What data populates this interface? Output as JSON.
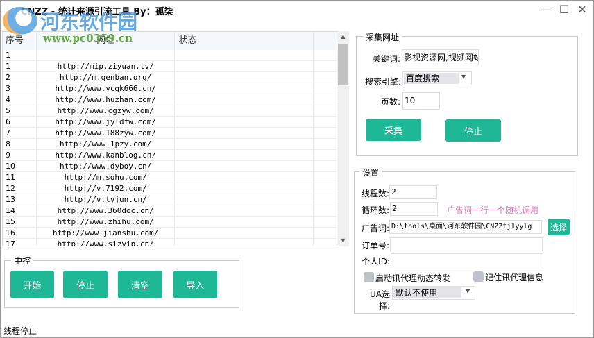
{
  "window": {
    "title": "CNZZ - 统计来源引流工具 By：孤柒",
    "minimize": "—",
    "maximize": "☐",
    "close": "✕"
  },
  "watermark": {
    "name": "河东软件园",
    "url": "www.pc0359.cn"
  },
  "table": {
    "headers": [
      "序号",
      "网址",
      "状态"
    ],
    "rows": [
      {
        "n": "1",
        "url": "",
        "status": ""
      },
      {
        "n": "1",
        "url": "http://mip.ziyuan.tv/",
        "status": ""
      },
      {
        "n": "2",
        "url": "http://m.genban.org/",
        "status": ""
      },
      {
        "n": "3",
        "url": "http://www.ycgk666.cn/",
        "status": ""
      },
      {
        "n": "4",
        "url": "http://www.huzhan.com/",
        "status": ""
      },
      {
        "n": "5",
        "url": "http://www.cgzyw.com/",
        "status": ""
      },
      {
        "n": "6",
        "url": "http://www.jyldfw.com/",
        "status": ""
      },
      {
        "n": "7",
        "url": "http://www.188zyw.com/",
        "status": ""
      },
      {
        "n": "8",
        "url": "http://www.1pzy.com/",
        "status": ""
      },
      {
        "n": "9",
        "url": "http://www.kanblog.cn/",
        "status": ""
      },
      {
        "n": "10",
        "url": "http://www.dyboy.cn/",
        "status": ""
      },
      {
        "n": "11",
        "url": "http://m.sohu.com/",
        "status": ""
      },
      {
        "n": "12",
        "url": "http://v.7192.com/",
        "status": ""
      },
      {
        "n": "13",
        "url": "http://v.tyjun.cn/",
        "status": ""
      },
      {
        "n": "14",
        "url": "http://www.360doc.cn/",
        "status": ""
      },
      {
        "n": "15",
        "url": "http://www.zhihu.com/",
        "status": ""
      },
      {
        "n": "16",
        "url": "http://www.jianshu.com/",
        "status": ""
      },
      {
        "n": "17",
        "url": "http://www.sizvip.cn/",
        "status": ""
      }
    ]
  },
  "control": {
    "title": "中控",
    "start": "开始",
    "stop": "停止",
    "clear": "清空",
    "import": "导入"
  },
  "collect": {
    "title": "采集网址",
    "keyword_label": "关键词:",
    "keyword_value": "影视资源网,视频网站",
    "engine_label": "搜索引擎:",
    "engine_value": "百度搜索",
    "pages_label": "页数:",
    "pages_value": "10",
    "collect_btn": "采集",
    "stop_btn": "停止"
  },
  "settings": {
    "title": "设置",
    "threads_label": "线程数:",
    "threads_value": "2",
    "loops_label": "循环数:",
    "loops_value": "2",
    "hint": "广告词一行一个随机调用",
    "ad_label": "广告词:",
    "ad_value": "D:\\tools\\桌面\\河东软件园\\CNZZtjlyylg",
    "choose_btn": "选择",
    "order_label": "订单号:",
    "order_value": "",
    "id_label": "个人ID:",
    "id_value": "",
    "proxy_forward": "启动讯代理动态转发",
    "remember_proxy": "记住讯代理信息",
    "ua_label": "UA选择:",
    "ua_value": "默认不使用"
  },
  "status": {
    "text": "线程停止"
  },
  "colors": {
    "accent": "#1fb896",
    "hint": "#e07ab8"
  }
}
